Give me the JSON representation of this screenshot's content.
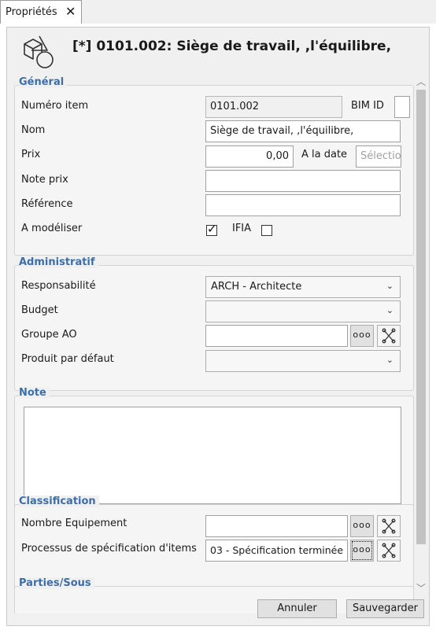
{
  "tab": {
    "label": "Propriétés",
    "close": "✕"
  },
  "header": {
    "title": "[*]  0101.002: Siège de travail, ,l'équilibre,"
  },
  "general": {
    "title": "Général",
    "numero_item": {
      "label": "Numéro item",
      "value": "0101.002"
    },
    "bim_id": {
      "label": "BIM ID",
      "value": ""
    },
    "nom": {
      "label": "Nom",
      "value": "Siège de travail, ,l'équilibre,"
    },
    "prix": {
      "label": "Prix",
      "value": "0,00"
    },
    "a_la_date": {
      "label": "A la date",
      "placeholder": "Sélectio"
    },
    "note_prix": {
      "label": "Note prix",
      "value": ""
    },
    "reference": {
      "label": "Référence",
      "value": ""
    },
    "a_modeliser": {
      "label": "A modéliser",
      "checked": true
    },
    "ifia": {
      "label": "IFIA",
      "checked": false
    }
  },
  "administratif": {
    "title": "Administratif",
    "responsabilite": {
      "label": "Responsabilité",
      "value": "ARCH - Architecte"
    },
    "budget": {
      "label": "Budget",
      "value": ""
    },
    "groupe_ao": {
      "label": "Groupe AO",
      "value": ""
    },
    "produit_defaut": {
      "label": "Produit par défaut",
      "value": ""
    }
  },
  "note": {
    "title": "Note",
    "value": ""
  },
  "classification": {
    "title": "Classification",
    "nombre_equipement": {
      "label": "Nombre Equipement",
      "value": ""
    },
    "processus": {
      "label": "Processus de spécification d'items",
      "value": "03 - Spécification terminée"
    }
  },
  "parties": {
    "title": "Parties/Sous"
  },
  "buttons": {
    "cancel": "Annuler",
    "save": "Sauvegarder",
    "dots": "ooo"
  },
  "icons": {
    "object": "shapes-icon",
    "remove": "remove-cross-icon",
    "dropdown": "chevron-down-icon"
  },
  "colors": {
    "section_title": "#3c6ea8"
  }
}
